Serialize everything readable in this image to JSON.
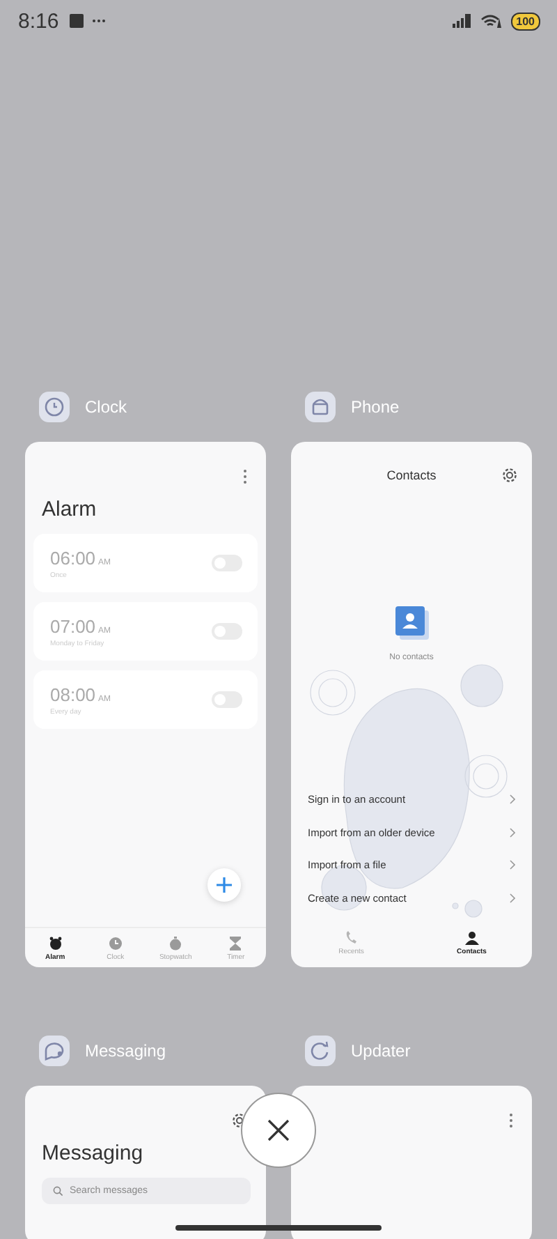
{
  "status_bar": {
    "time": "8:16",
    "battery": "100"
  },
  "apps": [
    {
      "name": "Clock",
      "kind": "clock",
      "screen": {
        "title": "Alarm",
        "alarms": [
          {
            "time": "06:00",
            "period": "AM",
            "repeat": "Once",
            "on": false
          },
          {
            "time": "07:00",
            "period": "AM",
            "repeat": "Monday to Friday",
            "on": false
          },
          {
            "time": "08:00",
            "period": "AM",
            "repeat": "Every day",
            "on": false
          }
        ],
        "tabs": [
          {
            "label": "Alarm",
            "selected": true
          },
          {
            "label": "Clock",
            "selected": false
          },
          {
            "label": "Stopwatch",
            "selected": false
          },
          {
            "label": "Timer",
            "selected": false
          }
        ]
      }
    },
    {
      "name": "Phone",
      "kind": "phone",
      "screen": {
        "title": "Contacts",
        "empty": "No contacts",
        "actions": [
          "Sign in to an account",
          "Import from an older device",
          "Import from a file",
          "Create a new contact"
        ],
        "tabs": [
          {
            "label": "Recents",
            "selected": false
          },
          {
            "label": "Contacts",
            "selected": true
          }
        ]
      }
    },
    {
      "name": "Messaging",
      "kind": "messaging",
      "screen": {
        "title": "Messaging",
        "search": {
          "placeholder": "Search messages"
        }
      }
    },
    {
      "name": "Updater",
      "kind": "updater"
    }
  ]
}
